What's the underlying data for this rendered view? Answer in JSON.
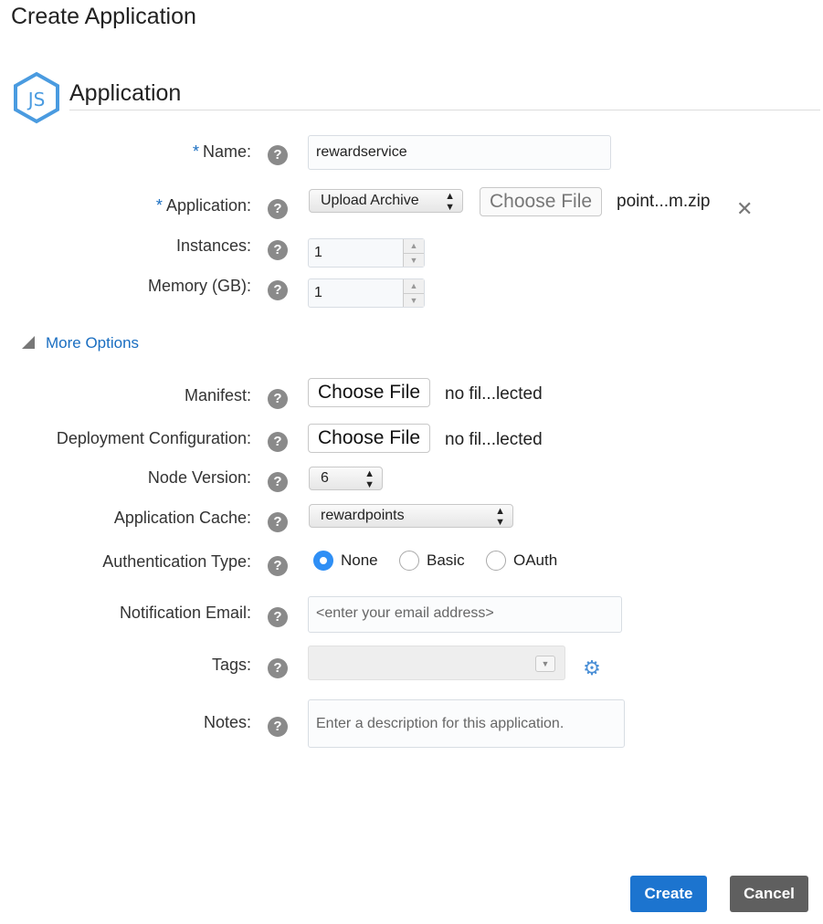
{
  "page": {
    "title": "Create Application"
  },
  "section": {
    "title": "Application",
    "logo_text": "JS"
  },
  "help_glyph": "?",
  "required_marker": "*",
  "fields": {
    "name": {
      "label": "Name:",
      "value": "rewardservice"
    },
    "application": {
      "label": "Application:",
      "source_select": "Upload Archive",
      "choose_file_label": "Choose File",
      "file_name": "point...m.zip",
      "remove_glyph": "✕"
    },
    "instances": {
      "label": "Instances:",
      "value": "1"
    },
    "memory": {
      "label": "Memory (GB):",
      "value": "1"
    }
  },
  "more_options": {
    "label": "More Options"
  },
  "options": {
    "manifest": {
      "label": "Manifest:",
      "choose_file_label": "Choose File",
      "file_status": "no fil...lected"
    },
    "deployment": {
      "label": "Deployment Configuration:",
      "choose_file_label": "Choose File",
      "file_status": "no fil...lected"
    },
    "node_version": {
      "label": "Node Version:",
      "value": "6"
    },
    "app_cache": {
      "label": "Application Cache:",
      "value": "rewardpoints"
    },
    "auth_type": {
      "label": "Authentication Type:",
      "options": [
        "None",
        "Basic",
        "OAuth"
      ],
      "selected": "None"
    },
    "notification_email": {
      "label": "Notification Email:",
      "placeholder": "<enter your email address>"
    },
    "tags": {
      "label": "Tags:",
      "value": ""
    },
    "notes": {
      "label": "Notes:",
      "placeholder": "Enter a description for this application."
    }
  },
  "buttons": {
    "create": "Create",
    "cancel": "Cancel"
  },
  "colors": {
    "accent": "#1c74cf",
    "link": "#1a6ec1",
    "cancel": "#5f5f5f",
    "radio_selected": "#2f8ff5"
  },
  "icons": [
    "js-logo",
    "help-icon",
    "close-icon",
    "triangle-icon",
    "gear-icon",
    "chevron-updown-icon"
  ]
}
